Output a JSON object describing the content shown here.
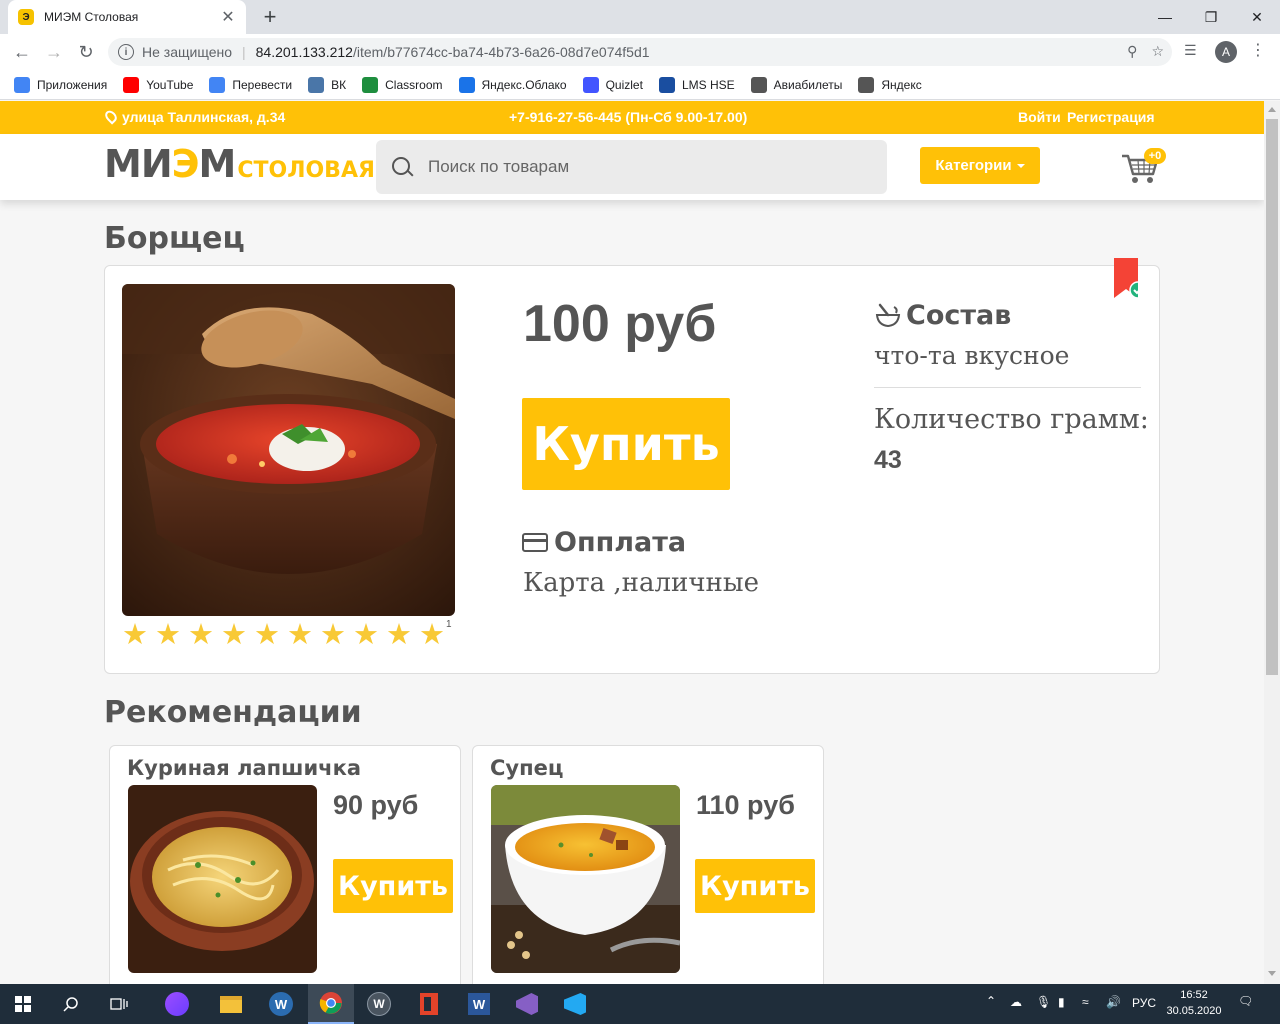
{
  "browser": {
    "tab_title": "МИЭМ Столовая",
    "tab_close": "✕",
    "new_tab": "+",
    "security_label": "Не защищено",
    "url_host": "84.201.133.212",
    "url_path": "/item/b77674cc-ba74-4b73-6a26-08d7e074f5d1",
    "profile_initial": "A",
    "bookmarks": [
      {
        "label": "Приложения",
        "color": "#4285f4"
      },
      {
        "label": "YouTube",
        "color": "#ff0000"
      },
      {
        "label": "Перевести",
        "color": "#4285f4"
      },
      {
        "label": "ВК",
        "color": "#4a76a8"
      },
      {
        "label": "Classroom",
        "color": "#1e8e3e"
      },
      {
        "label": "Яндекс.Облако",
        "color": "#1a73e8"
      },
      {
        "label": "Quizlet",
        "color": "#4255ff"
      },
      {
        "label": "LMS HSE",
        "color": "#1a4ea0"
      },
      {
        "label": "Авиабилеты",
        "color": "#555555"
      },
      {
        "label": "Яндекс",
        "color": "#555555"
      }
    ]
  },
  "site": {
    "address": "улица Таллинская, д.34",
    "phone": "+7-916-27-56-445 (Пн-Сб 9.00-17.00)",
    "login": "Войти",
    "register": "Регистрация",
    "logo_main_prefix": "МИ",
    "logo_main_e": "Э",
    "logo_main_suffix": "М",
    "logo_sub": "СТОЛОВАЯ",
    "search_placeholder": "Поиск по товарам",
    "categories_label": "Категории",
    "cart_badge": "+0",
    "accent_color": "#ffc107"
  },
  "product": {
    "title": "Борщец",
    "price": "100 руб",
    "buy_label": "Купить",
    "payment_title": "Опплата",
    "payment_value": "Карта ,наличные",
    "composition_title": "Состав",
    "composition_value": "что-та вкусное",
    "grams_title": "Количество грамм:",
    "grams_value": "43",
    "rating_stars": 10,
    "rating_count": "1"
  },
  "recommendations": {
    "title": "Рекомендации",
    "items": [
      {
        "name": "Куриная лапшичка",
        "price": "90 руб",
        "buy_label": "Купить"
      },
      {
        "name": "Супец",
        "price": "110 руб",
        "buy_label": "Купить"
      }
    ]
  },
  "taskbar": {
    "language": "РУС",
    "time": "16:52",
    "date": "30.05.2020"
  }
}
